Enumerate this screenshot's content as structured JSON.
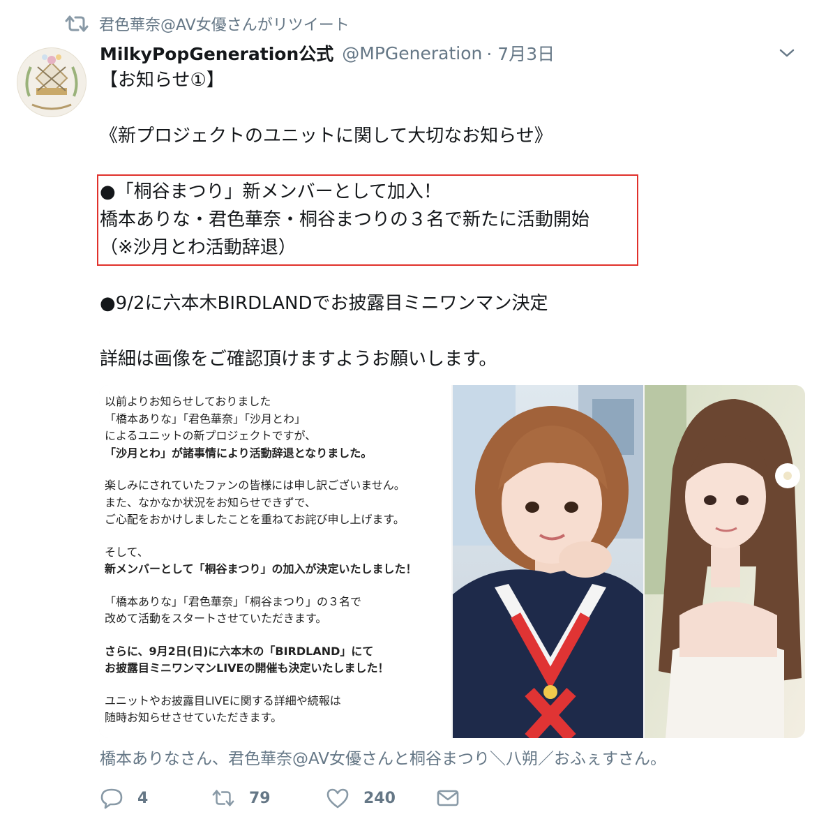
{
  "retweet": {
    "text": "君色華奈@AV女優さんがリツイート"
  },
  "author": {
    "name": "MilkyPopGeneration公式",
    "handle": "@MPGeneration",
    "date": "· 7月3日"
  },
  "tweet": {
    "lines": [
      "【お知らせ①】",
      "",
      "《新プロジェクトのユニットに関して大切なお知らせ》",
      "",
      "●「桐谷まつり」新メンバーとして加入！",
      "橋本ありな・君色華奈・桐谷まつりの３名で新たに活動開始",
      "（※沙月とわ活動辞退）",
      "",
      "●9/2に六本木BIRDLANDでお披露目ミニワンマン決定",
      "",
      "詳細は画像をご確認頂けますようお願いします。"
    ]
  },
  "notice": {
    "lines": [
      "以前よりお知らせしておりました",
      "「橋本ありな」「君色華奈」「沙月とわ」",
      "によるユニットの新プロジェクトですが、",
      "「沙月とわ」が諸事情により活動辞退となりました。",
      "",
      "楽しみにされていたファンの皆様には申し訳ございません。",
      "また、なかなか状況をお知らせできずで、",
      "ご心配をおかけしましたことを重ねてお詫び申し上げます。",
      "",
      "そして、",
      "新メンバーとして「桐谷まつり」の加入が決定いたしました！",
      "",
      "「橋本ありな」「君色華奈」「桐谷まつり」の３名で",
      "改めて活動をスタートさせていただきます。",
      "",
      "さらに、9月2日(日)に六本木の「BIRDLAND」にて",
      "お披露目ミニワンマンLIVEの開催も決定いたしました！",
      "",
      "ユニットやお披露目LIVEに関する詳細や続報は",
      "随時お知らせさせていただきます。"
    ]
  },
  "mentions": "橋本ありなさん、君色華奈@AV女優さんと桐谷まつり＼八朔／おふぇすさん。",
  "actions": {
    "replies": "4",
    "retweets": "79",
    "likes": "240"
  },
  "colors": {
    "muted": "#657786",
    "highlight_border": "#e0302b",
    "text": "#14171a"
  }
}
